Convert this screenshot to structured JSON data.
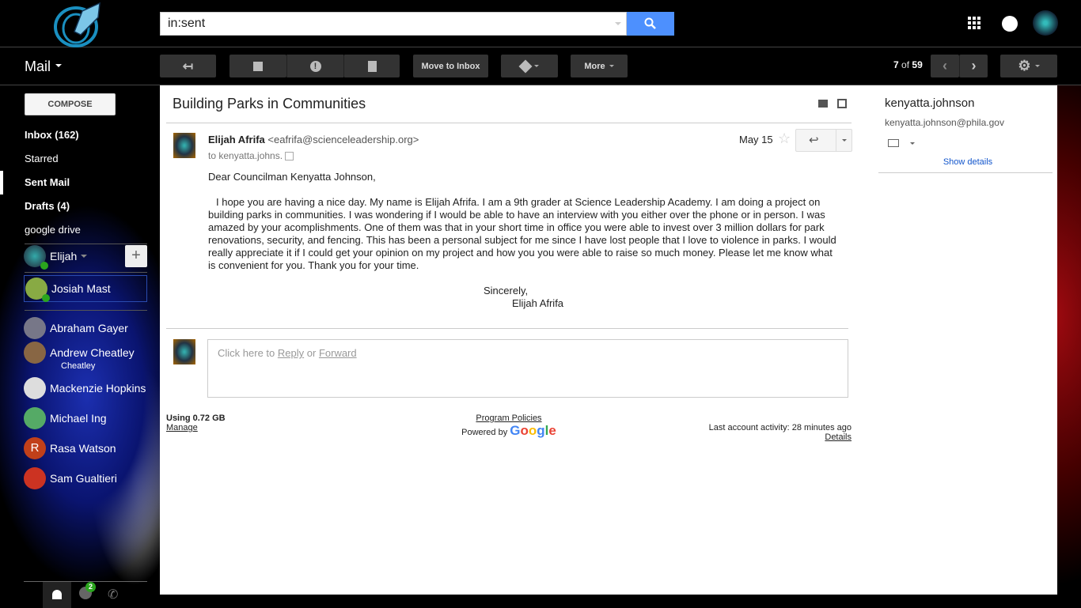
{
  "search": {
    "value": "in:sent"
  },
  "toolbar": {
    "mail_label": "Mail",
    "move_to_inbox": "Move to Inbox",
    "more": "More",
    "count_current": "7",
    "count_of": "of",
    "count_total": "59"
  },
  "sidebar": {
    "compose": "COMPOSE",
    "items": [
      {
        "label": "Inbox (162)"
      },
      {
        "label": "Starred"
      },
      {
        "label": "Sent Mail"
      },
      {
        "label": "Drafts (4)"
      },
      {
        "label": "google drive"
      }
    ],
    "me": "Elijah",
    "contacts": [
      {
        "name": "Josiah Mast"
      },
      {
        "name": "Abraham Gayer"
      },
      {
        "name": "Andrew Cheatley",
        "sub": "Cheatley"
      },
      {
        "name": "Mackenzie Hopkins"
      },
      {
        "name": "Michael Ing"
      },
      {
        "name": "Rasa Watson",
        "initial": "R"
      },
      {
        "name": "Sam Gualtieri"
      }
    ],
    "hangouts_badge": "2"
  },
  "email": {
    "subject": "Building Parks in Communities",
    "sender_name": "Elijah Afrifa",
    "sender_email": "<eafrifa@scienceleadership.org>",
    "to": "to kenyatta.johns.",
    "date": "May 15",
    "greeting": "Dear Councilman Kenyatta Johnson,",
    "body": "I hope you are having a nice day. My name is Elijah Afrifa. I am a 9th grader at Science Leadership Academy. I am doing a project on building parks in communities. I was wondering if I would be able to have an interview with you either over the phone or in person. I was amazed by your acomplishments. One of them was that in your short time in office you were able to invest over 3 million dollars for park renovations, security, and fencing. This has been a personal subject for me since I have lost people that I love to violence in parks. I would really appreciate it if I could get your opinion on my project and how you you were able to raise so much money. Please let me know what is convenient for you. Thank you for your time.",
    "closing": "Sincerely,",
    "signature": "Elijah Afrifa",
    "reply_prompt": "Click here to",
    "reply_link": "Reply",
    "or": "or",
    "forward_link": "Forward"
  },
  "footer": {
    "usage": "Using 0.72 GB",
    "manage": "Manage",
    "policies": "Program Policies",
    "powered": "Powered by",
    "activity": "Last account activity: 28 minutes ago",
    "details": "Details"
  },
  "contact_panel": {
    "name": "kenyatta.johnson",
    "email": "kenyatta.johnson@phila.gov",
    "show_details": "Show details"
  },
  "colors": {
    "search_button": "#4d90fe",
    "online": "#2aa51d",
    "link": "#1155cc"
  }
}
